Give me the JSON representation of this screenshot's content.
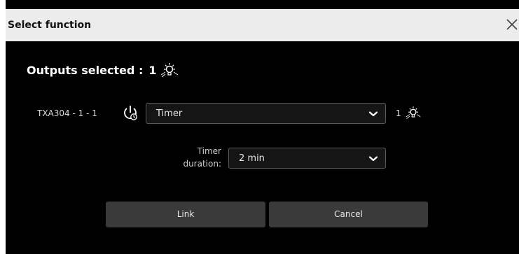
{
  "dialog": {
    "title": "Select function",
    "close_icon": "close-icon"
  },
  "outputs": {
    "label": "Outputs selected :",
    "count": "1",
    "icon": "light-bulb-icon"
  },
  "function_row": {
    "device": "TXA304 - 1 - 1",
    "device_icon": "power-timer-icon",
    "function_value": "Timer",
    "chevron_icon": "chevron-down-icon",
    "output_count": "1",
    "output_icon": "light-bulb-icon"
  },
  "timer_duration": {
    "label_line1": "Timer",
    "label_line2": "duration:",
    "value": "2 min",
    "chevron_icon": "chevron-down-icon"
  },
  "buttons": {
    "link_label": "Link",
    "cancel_label": "Cancel"
  },
  "colors": {
    "titlebar_bg": "#ececec",
    "dialog_bg": "#000000",
    "button_bg": "#3a3a3a",
    "select_bg": "#151515",
    "select_border": "#5a5a5a"
  }
}
